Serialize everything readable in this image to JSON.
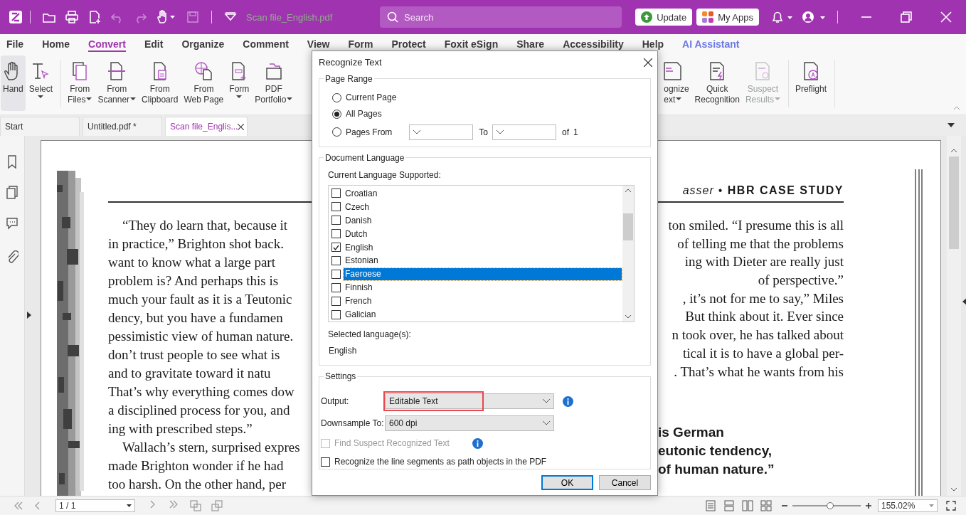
{
  "title_bar": {
    "file_name": "Scan file_English.pdf",
    "search_placeholder": "Search",
    "buttons": [
      "Update",
      "My Apps"
    ]
  },
  "menu": [
    {
      "label": "File",
      "selected": false
    },
    {
      "label": "Home",
      "selected": false
    },
    {
      "label": "Convert",
      "selected": true
    },
    {
      "label": "Edit",
      "selected": false
    },
    {
      "label": "Organize",
      "selected": false
    },
    {
      "label": "Comment",
      "selected": false
    },
    {
      "label": "View",
      "selected": false
    },
    {
      "label": "Form",
      "selected": false
    },
    {
      "label": "Protect",
      "selected": false
    },
    {
      "label": "Foxit eSign",
      "selected": false
    },
    {
      "label": "Share",
      "selected": false
    },
    {
      "label": "Accessibility",
      "selected": false
    },
    {
      "label": "Help",
      "selected": false
    },
    {
      "label": "AI Assistant",
      "selected": false,
      "kind": "ai"
    }
  ],
  "ribbon": [
    {
      "lines": [
        "Hand"
      ],
      "dropdown": false,
      "disabled": false,
      "selected": true
    },
    {
      "lines": [
        "Select"
      ],
      "dropdown": true,
      "disabled": false,
      "selected": false
    },
    {
      "lines": [
        "From",
        "Files"
      ],
      "dropdown": true,
      "disabled": false,
      "selected": false
    },
    {
      "lines": [
        "From",
        "Scanner"
      ],
      "dropdown": true,
      "disabled": false,
      "selected": false
    },
    {
      "lines": [
        "From",
        "Clipboard"
      ],
      "dropdown": false,
      "disabled": false,
      "selected": false
    },
    {
      "lines": [
        "From",
        "Web Page"
      ],
      "dropdown": false,
      "disabled": false,
      "selected": false
    },
    {
      "lines": [
        "Form"
      ],
      "dropdown": true,
      "disabled": false,
      "selected": false
    },
    {
      "lines": [
        "PDF",
        "Portfolio"
      ],
      "dropdown": true,
      "disabled": false,
      "selected": false
    },
    {
      "lines": [
        "ognize",
        "ext"
      ],
      "dropdown": true,
      "disabled": false,
      "selected": false
    },
    {
      "lines": [
        "Quick",
        "Recognition"
      ],
      "dropdown": false,
      "disabled": false,
      "selected": false
    },
    {
      "lines": [
        "Suspect",
        "Results"
      ],
      "dropdown": true,
      "disabled": true,
      "selected": false
    },
    {
      "lines": [
        "Preflight"
      ],
      "dropdown": false,
      "disabled": false,
      "selected": false
    }
  ],
  "tabs": [
    {
      "label": "Start",
      "selected": false,
      "closable": false
    },
    {
      "label": "Untitled.pdf *",
      "selected": false,
      "closable": false
    },
    {
      "label": "Scan file_Englis...",
      "selected": true,
      "closable": true
    }
  ],
  "document": {
    "header": "*asser* • **HBR CASE STUDY**",
    "left_lines": [
      "“They do learn that, because it",
      "in practice,” Brighton shot back.",
      "want to know what a large part",
      "problem is? And perhaps this is",
      "much your fault as it is a Teutonic",
      "dency, but you have a fundamen",
      "pessimistic view of human nature.",
      "don’t trust people to see what is",
      "and to gravitate toward it natu",
      "That’s why everything comes dow",
      "a disciplined process for you, and",
      "ing with prescribed steps.”",
      "Wallach’s stern, surprised expres",
      "made Brighton wonder if he had",
      "too harsh. On the other hand, per"
    ],
    "right_lines": [
      "ton smiled. “I presume this is all",
      "of telling me that the problems",
      "ing with Dieter are really just",
      "of perspective.”",
      ", it’s not for me to say,” Miles",
      "But think about it. Ever since",
      "n took over, he has talked about",
      "tical it is to have a global per-",
      ". That’s what he wants from his"
    ],
    "quote_lines": [
      "is German",
      "eutonic tendency,",
      "of human nature.”"
    ]
  },
  "dialog": {
    "title": "Recognize Text",
    "page_range": {
      "legend": "Page Range",
      "options": [
        {
          "label": "Current Page",
          "selected": false
        },
        {
          "label": "All Pages",
          "selected": true
        },
        {
          "label": "Pages From",
          "selected": false
        }
      ],
      "to_label": "To",
      "of_label": "of",
      "of_value": "1"
    },
    "language": {
      "legend": "Document Language",
      "list_label": "Current Language Supported:",
      "items": [
        {
          "label": "Croatian",
          "checked": false,
          "selected": false
        },
        {
          "label": "Czech",
          "checked": false,
          "selected": false
        },
        {
          "label": "Danish",
          "checked": false,
          "selected": false
        },
        {
          "label": "Dutch",
          "checked": false,
          "selected": false
        },
        {
          "label": "English",
          "checked": true,
          "selected": false
        },
        {
          "label": "Estonian",
          "checked": false,
          "selected": false
        },
        {
          "label": "Faeroese",
          "checked": false,
          "selected": true
        },
        {
          "label": "Finnish",
          "checked": false,
          "selected": false
        },
        {
          "label": "French",
          "checked": false,
          "selected": false
        },
        {
          "label": "Galician",
          "checked": false,
          "selected": false
        }
      ],
      "selected_label": "Selected language(s):",
      "selected_value": "English"
    },
    "settings": {
      "legend": "Settings",
      "output_label": "Output:",
      "output_value": "Editable Text",
      "output_highlighted": true,
      "downsample_label": "Downsample To:",
      "downsample_value": "600 dpi",
      "checks": [
        {
          "label": "Find Suspect Recognized Text",
          "checked": false,
          "disabled": true,
          "info": true
        },
        {
          "label": "Recognize the line segments as path objects in the PDF",
          "checked": false,
          "disabled": false,
          "info": false
        }
      ]
    },
    "buttons": [
      {
        "label": "OK",
        "default": true
      },
      {
        "label": "Cancel",
        "default": false
      }
    ]
  },
  "status_bar": {
    "page": "1 / 1",
    "zoom": "155.02%",
    "zoom_slider": {
      "level": 0.55
    }
  }
}
